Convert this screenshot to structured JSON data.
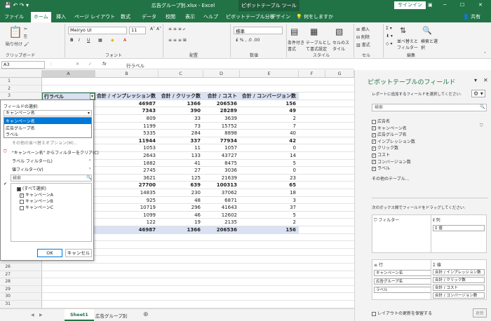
{
  "app": {
    "title": "広告グループ別.xlsx - Excel",
    "tool": "ピボットテーブル ツール",
    "signin": "サインイン"
  },
  "tabs": [
    "ファイル",
    "ホーム",
    "挿入",
    "ページ レイアウト",
    "数式",
    "データ",
    "校閲",
    "表示",
    "ヘルプ",
    "ピボットテーブル分析",
    "デザイン",
    "何をしますか"
  ],
  "share": "共有",
  "ribbon": {
    "paste": "貼り付け",
    "clipboard": "クリップボード",
    "font_name": "Meiryo UI",
    "font_size": "11",
    "font_group": "フォント",
    "align_group": "配置",
    "number_format": "標準",
    "number_group": "数値",
    "cond_format": "条件付き書式",
    "table_format": "テーブルとして書式設定",
    "cell_style": "セルのスタイル",
    "style_group": "スタイル",
    "insert": "挿入",
    "delete": "削除",
    "format": "書式",
    "cell_group": "セル",
    "sort": "並べ替えとフィルター",
    "find": "検索と選択",
    "edit_group": "編集"
  },
  "formula": {
    "namebox": "A3",
    "content": "行ラベル"
  },
  "columns": [
    "A",
    "B",
    "C",
    "D",
    "E",
    "F",
    "G"
  ],
  "rows": [
    "1",
    "2",
    "3",
    "4",
    "5",
    "6",
    "7",
    "8",
    "9",
    "10",
    "11",
    "12",
    "13",
    "14",
    "15",
    "16",
    "17",
    "18",
    "19",
    "20",
    "21",
    "22",
    "23",
    "24",
    "25",
    "26",
    "27",
    "28",
    "29",
    "30",
    "31",
    "32"
  ],
  "pivot": {
    "headers": [
      "行ラベル",
      "合計 / インプレッション数",
      "合計 / クリック数",
      "合計 / コスト",
      "合計 / コンバージョン数"
    ],
    "rows": [
      [
        "46987",
        "1366",
        "206536",
        "156"
      ],
      [
        "7343",
        "390",
        "28289",
        "49"
      ],
      [
        "809",
        "33",
        "3639",
        "2"
      ],
      [
        "1199",
        "73",
        "15752",
        "7"
      ],
      [
        "5335",
        "284",
        "8898",
        "40"
      ],
      [
        "11944",
        "337",
        "77934",
        "42"
      ],
      [
        "1053",
        "11",
        "1057",
        "0"
      ],
      [
        "2643",
        "133",
        "43727",
        "14"
      ],
      [
        "1882",
        "41",
        "8475",
        "5"
      ],
      [
        "2745",
        "27",
        "3036",
        "0"
      ],
      [
        "3621",
        "125",
        "21639",
        "23"
      ],
      [
        "27700",
        "639",
        "100313",
        "65"
      ],
      [
        "14835",
        "230",
        "37062",
        "18"
      ],
      [
        "925",
        "48",
        "6871",
        "3"
      ],
      [
        "10719",
        "296",
        "41643",
        "37"
      ],
      [
        "1099",
        "46",
        "12602",
        "5"
      ],
      [
        "122",
        "19",
        "2135",
        "2"
      ],
      [
        "46987",
        "1366",
        "206536",
        "156"
      ]
    ]
  },
  "dropdown": {
    "field_label": "フィールドの選択:",
    "field_value": "キャンペーン名",
    "options": [
      "キャンペーン名",
      "広告グループ名",
      "ラベル"
    ],
    "more_sort": "その他の並べ替えオプション(M)...",
    "clear": "\"キャンペーン名\" からフィルターをクリア(C)",
    "label_filter": "ラベル フィルター(L)",
    "value_filter": "値フィルター(V)",
    "search": "検索",
    "items": [
      "(すべて選択)",
      "キャンペーンA",
      "キャンペーンB",
      "キャンペーンC"
    ],
    "ok": "OK",
    "cancel": "キャンセル"
  },
  "sheets": [
    "Sheet1",
    "広告グループ別"
  ],
  "pane": {
    "title": "ピボットテーブルのフィールド",
    "subtitle": "レポートに追加するフィールドを選択してください:",
    "search": "検索",
    "fields": [
      "広告名",
      "キャンペーン名",
      "広告グループ名",
      "インプレッション数",
      "クリック数",
      "コスト",
      "コンバージョン数",
      "ラベル"
    ],
    "field_checked": [
      false,
      true,
      true,
      true,
      true,
      true,
      true,
      true
    ],
    "other_tables": "その他のテーブル...",
    "drag_hint": "次のボックス間でフィールドをドラッグしてください:",
    "filter": "フィルター",
    "columns": "列",
    "values_chip": "Σ 値",
    "rows": "行",
    "values": "値",
    "row_items": [
      "キャンペーン名",
      "広告グループ名",
      "ラベル"
    ],
    "value_items": [
      "合計 / インプレッション数",
      "合計 / クリック数",
      "合計 / コスト",
      "合計 / コンバージョン数"
    ],
    "defer": "レイアウトの更新を保留する",
    "update": "更新"
  }
}
